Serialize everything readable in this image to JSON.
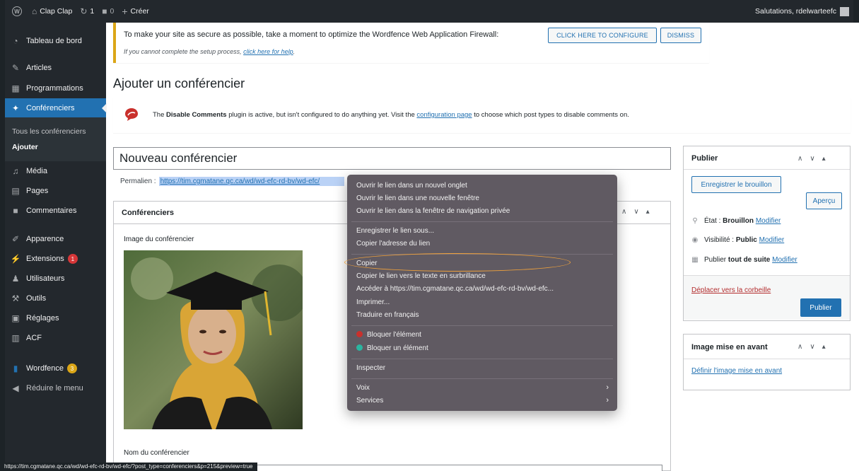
{
  "admin_bar": {
    "site_name": "Clap Clap",
    "updates_count": "1",
    "comments_count": "0",
    "new_label": "Créer",
    "greeting": "Salutations, rdelwarteefc"
  },
  "sidebar": {
    "items": [
      {
        "label": "Tableau de bord",
        "icon": "dashboard-icon"
      },
      {
        "label": "Articles",
        "icon": "pin-icon"
      },
      {
        "label": "Programmations",
        "icon": "calendar-icon"
      },
      {
        "label": "Conférenciers",
        "icon": "pin-icon"
      },
      {
        "label": "Média",
        "icon": "media-icon"
      },
      {
        "label": "Pages",
        "icon": "page-icon"
      },
      {
        "label": "Commentaires",
        "icon": "comment-icon"
      },
      {
        "label": "Apparence",
        "icon": "brush-icon"
      },
      {
        "label": "Extensions",
        "icon": "plugin-icon",
        "badge": "1"
      },
      {
        "label": "Utilisateurs",
        "icon": "users-icon"
      },
      {
        "label": "Outils",
        "icon": "wrench-icon"
      },
      {
        "label": "Réglages",
        "icon": "settings-icon"
      },
      {
        "label": "ACF",
        "icon": "grid-icon"
      },
      {
        "label": "Wordfence",
        "icon": "wordfence-icon",
        "badge": "3"
      },
      {
        "label": "Réduire le menu",
        "icon": "collapse-icon"
      }
    ],
    "submenu": [
      {
        "label": "Tous les conférenciers"
      },
      {
        "label": "Ajouter"
      }
    ],
    "badge_colors": {
      "extensions": "#d63638",
      "wordfence": "#dba617"
    },
    "active_color": "#2271b1"
  },
  "wordfence_notice": {
    "text": "To make your site as secure as possible, take a moment to optimize the Wordfence Web Application Firewall:",
    "configure_button": "CLICK HERE TO CONFIGURE",
    "dismiss_button": "DISMISS",
    "subtext": "If you cannot complete the setup process,",
    "help_link": "click here for help"
  },
  "page_title": "Ajouter un conférencier",
  "disable_comments_notice": {
    "prefix": "The",
    "plugin_name": "Disable Comments",
    "middle": "plugin is active, but isn't configured to do anything yet. Visit the",
    "link": "configuration page",
    "suffix": "to choose which post types to disable comments on."
  },
  "title_field": {
    "value": "Nouveau conférencier"
  },
  "permalink": {
    "label": "Permalien :",
    "url": "https://tim.cgmatane.qc.ca/wd/wd-efc-rd-bv/wd-efc/"
  },
  "conferenciers_box": {
    "title": "Conférenciers",
    "image_label": "Image du conférencier",
    "name_label": "Nom du conférencier"
  },
  "publish_box": {
    "title": "Publier",
    "save_draft": "Enregistrer le brouillon",
    "preview": "Aperçu",
    "status_label": "État :",
    "status_value": "Brouillon",
    "visibility_label": "Visibilité :",
    "visibility_value": "Public",
    "schedule_label": "Publier",
    "schedule_value": "tout de suite",
    "modify": "Modifier",
    "trash": "Déplacer vers la corbeille",
    "publish": "Publier"
  },
  "featured_box": {
    "title": "Image mise en avant",
    "link": "Définir l'image mise en avant"
  },
  "context_menu": {
    "items": [
      "Ouvrir le lien dans un nouvel onglet",
      "Ouvrir le lien dans une nouvelle fenêtre",
      "Ouvrir le lien dans la fenêtre de navigation privée",
      "Enregistrer le lien sous...",
      "Copier l'adresse du lien",
      "Copier",
      "Copier le lien vers le texte en surbrillance",
      "Accéder à https://tim.cgmatane.qc.ca/wd/wd-efc-rd-bv/wd-efc...",
      "Imprimer...",
      "Traduire en français",
      "Bloquer l'élément",
      "Bloquer un élément",
      "Inspecter",
      "Voix",
      "Services"
    ],
    "highlight_color": "#f0a23c"
  },
  "status_bar": {
    "url": "https://tim.cgmatane.qc.ca/wd/wd-efc-rd-bv/wd-efc/?post_type=conferenciers&p=215&preview=true"
  }
}
